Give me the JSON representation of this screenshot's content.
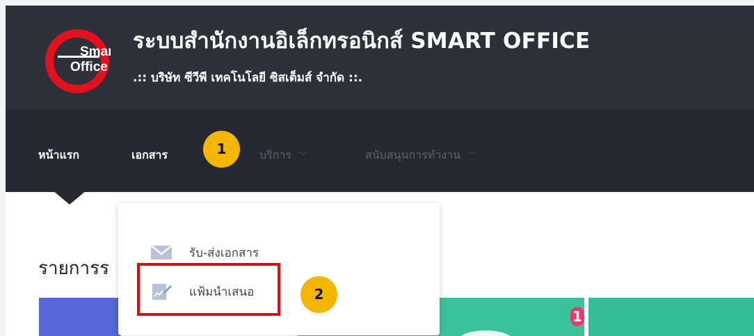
{
  "header": {
    "logo_text_1": "Smart",
    "logo_text_2": "Office",
    "title": "ระบบสำนักงานอิเล็กทรอนิกส์ SMART OFFICE",
    "subtitle": ".:: บริษัท ซีวีพี เทคโนโลยี ซิสเต็มส์ จำกัด ::."
  },
  "nav": {
    "items": [
      {
        "label": "หน้าแรก"
      },
      {
        "label": "เอกสาร"
      },
      {
        "label": "บริการ"
      },
      {
        "label": "สนับสนุนการทำงาน"
      }
    ],
    "caret": "﹀"
  },
  "dropdown": {
    "items": [
      {
        "label": "รับ-ส่งเอกสาร",
        "icon": "envelope-icon"
      },
      {
        "label": "แฟ้มนำเสนอ",
        "icon": "document-edit-icon"
      }
    ]
  },
  "annotations": {
    "step1": "1",
    "step2": "2"
  },
  "main": {
    "section_title": "รายการร",
    "card_badge": "1"
  },
  "colors": {
    "header_bg": "#2e313a",
    "navbar_bg": "#262931",
    "annotation_yellow": "#f5b602",
    "highlight_red": "#e20b0b",
    "card_blue": "#5667d9",
    "card_teal": "#3bc29b",
    "badge_pink": "#e63a6c"
  }
}
